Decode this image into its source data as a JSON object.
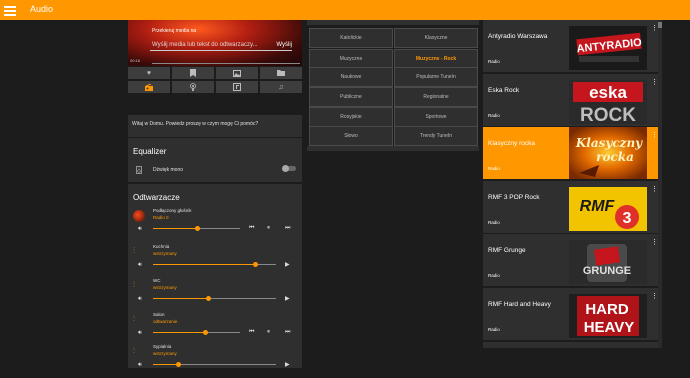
{
  "app": {
    "title": "Audio"
  },
  "media": {
    "cast_label": "Przekieruj media na",
    "input_placeholder": "Wyślij media lub tekst do odtwarzaczy...",
    "send_label": "Wyślij",
    "time": "00:16"
  },
  "icon_row_1": [
    "heart-icon",
    "bookmark-icon",
    "photo-icon",
    "folder-icon"
  ],
  "icon_row_2": [
    "radio-icon",
    "podcast-icon",
    "music-library-icon",
    "music-note-icon"
  ],
  "assistant": {
    "text": "Witaj w Domu. Powiedz proszę w czym mogę Ci pomóc?"
  },
  "equalizer": {
    "title": "Equalizer",
    "mono_label": "Dźwięk mono",
    "mono_on": false
  },
  "players": {
    "title": "Odtwarzacze",
    "items": [
      {
        "name": "Podłączony głośnik",
        "state": "Radio 0",
        "volume": 0.5,
        "controls": [
          "skip-previous-icon",
          "pause-icon",
          "skip-next-icon"
        ]
      },
      {
        "name": "Kuchnia",
        "state": "wstrzymany",
        "volume": 0.83,
        "controls": [
          "play-icon"
        ]
      },
      {
        "name": "WC",
        "state": "wstrzymany",
        "volume": 0.45,
        "controls": [
          "play-icon"
        ]
      },
      {
        "name": "Salon",
        "state": "odtwarzanie",
        "volume": 0.6,
        "controls": [
          "skip-previous-icon",
          "pause-icon",
          "skip-next-icon"
        ]
      },
      {
        "name": "Sypialnia",
        "state": "wstrzymany",
        "volume": 0.2,
        "controls": [
          "play-icon"
        ]
      }
    ]
  },
  "categories": [
    {
      "label": "Katolickie",
      "active": false
    },
    {
      "label": "Klasyczne",
      "active": false
    },
    {
      "label": "Muzyczne",
      "active": false
    },
    {
      "label": "Muzyczne - Rock",
      "active": true
    },
    {
      "label": "Naukowe",
      "active": false
    },
    {
      "label": "Popularne TuneIn",
      "active": false
    },
    {
      "label": "Publiczne",
      "active": false
    },
    {
      "label": "Regionalne",
      "active": false
    },
    {
      "label": "Rosyjskie",
      "active": false
    },
    {
      "label": "Sportowe",
      "active": false
    },
    {
      "label": "Słowo",
      "active": false
    },
    {
      "label": "Trendy TuneIn",
      "active": false
    }
  ],
  "stations": [
    {
      "name": "Antyradio Warszawa",
      "sub": "Radio",
      "active": false,
      "logo_text": "ANTYRADIO"
    },
    {
      "name": "Eska Rock",
      "sub": "Radio",
      "active": false,
      "logo_text": "eska ROCK"
    },
    {
      "name": "Klasyczny rocka",
      "sub": "Radio",
      "active": true,
      "logo_text": "Klasyczny rocka"
    },
    {
      "name": "RMF 3 POP Rock",
      "sub": "Radio",
      "active": false,
      "logo_text": "RMF 3"
    },
    {
      "name": "RMF Grunge",
      "sub": "Radio",
      "active": false,
      "logo_text": "GRUNGE"
    },
    {
      "name": "RMF Hard and Heavy",
      "sub": "Radio",
      "active": false,
      "logo_text": "HARD & HEAVY"
    }
  ],
  "colors": {
    "accent": "#ff9800",
    "card": "#2f2f2f",
    "background": "#1c1c1c"
  }
}
